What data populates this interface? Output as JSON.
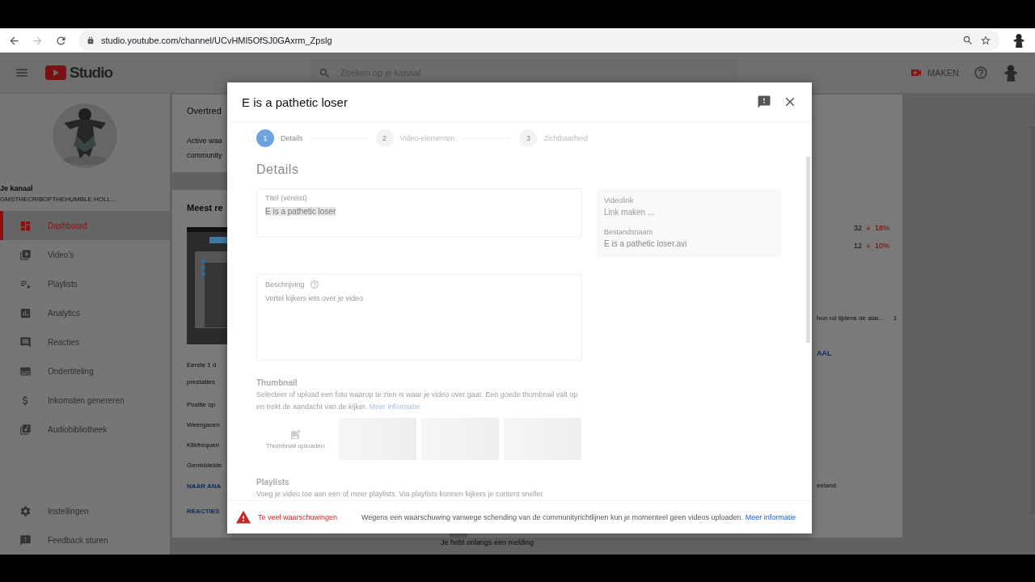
{
  "browser": {
    "url": "studio.youtube.com/channel/UCvHMI5OfSJ0GAxrm_Zpslg"
  },
  "header": {
    "logo": "Studio",
    "search_placeholder": "Zoeken op je kanaal",
    "create_button": "MAKEN"
  },
  "sidebar": {
    "channel_label": "Je kanaal",
    "channel_name": "GMSTHECRIBOFTHEHUMBLE HOLL...",
    "items": [
      {
        "label": "Dashboard",
        "selected": true
      },
      {
        "label": "Video's",
        "selected": false
      },
      {
        "label": "Playlists",
        "selected": false
      },
      {
        "label": "Analytics",
        "selected": false
      },
      {
        "label": "Reacties",
        "selected": false
      },
      {
        "label": "Ondertiteling",
        "selected": false
      },
      {
        "label": "Inkomsten genereren",
        "selected": false
      },
      {
        "label": "Audiobibliotheek",
        "selected": false
      }
    ],
    "bottom_items": [
      {
        "label": "Instellingen",
        "selected": false
      },
      {
        "label": "Feedback sturen",
        "selected": false
      }
    ]
  },
  "background": {
    "violations_title": "Overtred",
    "violations_lines": [
      "Active waa",
      "community"
    ],
    "recent_title": "Meest re",
    "recent_lines": [
      "Eerste 1 d",
      "prestaties"
    ],
    "stats": [
      "Positie op",
      "Weergaven",
      "Klikfrequen",
      "Gemiddelde"
    ],
    "links": [
      "NAAR ANA",
      "REACTIES"
    ],
    "metrics": [
      {
        "value": "32",
        "change": "18%"
      },
      {
        "value": "12",
        "change": "10%"
      }
    ],
    "comment": {
      "text": "hun rol tijdens de alar...",
      "count": "1"
    },
    "channel_link": "AAL",
    "location": "eeland",
    "notice": "Je hebt onlangs een melding"
  },
  "dialog": {
    "title": "E is a pathetic loser",
    "steps": [
      {
        "number": "1",
        "label": "Details",
        "selected": true
      },
      {
        "number": "2",
        "label": "Video-elementen",
        "selected": false
      },
      {
        "number": "3",
        "label": "Zichtbaarheid",
        "selected": false
      }
    ],
    "heading": "Details",
    "title_field": {
      "label": "Titel (vereist)",
      "value": "E is a pathetic loser"
    },
    "description_field": {
      "label": "Beschrijving",
      "placeholder": "Vertel kijkers iets over je video"
    },
    "info": [
      {
        "label": "Videolink",
        "value": "Link maken ..."
      },
      {
        "label": "Bestandsnaam",
        "value": "E is a pathetic loser.avi"
      }
    ],
    "thumbnail": {
      "heading": "Thumbnail",
      "text": "Selecteer of upload een foto waarop te zien is waar je video over gaat. Een goede thumbnail valt op en trekt de aandacht van de kijker.",
      "link": "Meer informatie",
      "upload": "Thumbnail uploaden"
    },
    "playlists": {
      "heading": "Playlists",
      "text": "Voeg je video toe aan een of meer playlists. Via playlists kunnen kijkers je content sneller"
    },
    "footer": {
      "warning": "Te veel waarschuwingen",
      "message": "Wegens een waarschuwing vanwege schending van de communityrichtlijnen kun je momenteel geen videos uploaden.",
      "link": "Meer informatie"
    }
  }
}
